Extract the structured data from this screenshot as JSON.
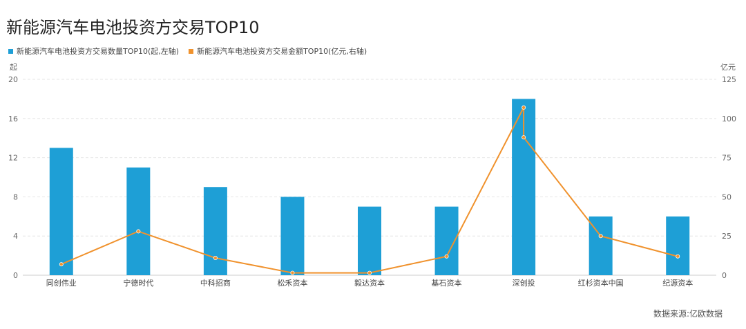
{
  "chart_data": {
    "type": "bar",
    "title": "新能源汽车电池投资方交易TOP10",
    "categories": [
      "同创伟业",
      "宁德时代",
      "中科招商",
      "松禾资本",
      "毅达资本",
      "基石资本",
      "深创投",
      "红杉资本中国",
      "纪源资本"
    ],
    "series": [
      {
        "name": "新能源汽车电池投资方交易数量TOP10(起,左轴)",
        "type": "bar",
        "axis": "left",
        "values": [
          13,
          11,
          9,
          8,
          7,
          7,
          18,
          6,
          6
        ]
      },
      {
        "name": "新能源汽车电池投资方交易金额TOP10(亿元,右轴)",
        "type": "line",
        "axis": "right",
        "points": [
          {
            "category": "同创伟业",
            "value": 7
          },
          {
            "category": "宁德时代",
            "value": 28
          },
          {
            "category": "中科招商",
            "value": 11
          },
          {
            "category": "松禾资本",
            "value": 1.5
          },
          {
            "category": "毅达资本",
            "value": 1.5
          },
          {
            "category": "基石资本",
            "value": 12
          },
          {
            "category": "深创投",
            "value": 107
          },
          {
            "category": "深创投",
            "value": 88
          },
          {
            "category": "红杉资本中国",
            "value": 25
          },
          {
            "category": "纪源资本",
            "value": 12
          }
        ]
      }
    ],
    "left_axis": {
      "label": "起",
      "ylim": [
        0,
        20
      ],
      "ticks": [
        0,
        4,
        8,
        12,
        16,
        20
      ]
    },
    "right_axis": {
      "label": "亿元",
      "ylim": [
        0,
        125
      ],
      "ticks": [
        0,
        25,
        50,
        75,
        100,
        125
      ]
    },
    "grid": true,
    "legend_position": "top-left",
    "colors": {
      "bar": "#1e9fd6",
      "line": "#f0922d"
    }
  },
  "source": "数据来源:亿欧数据"
}
